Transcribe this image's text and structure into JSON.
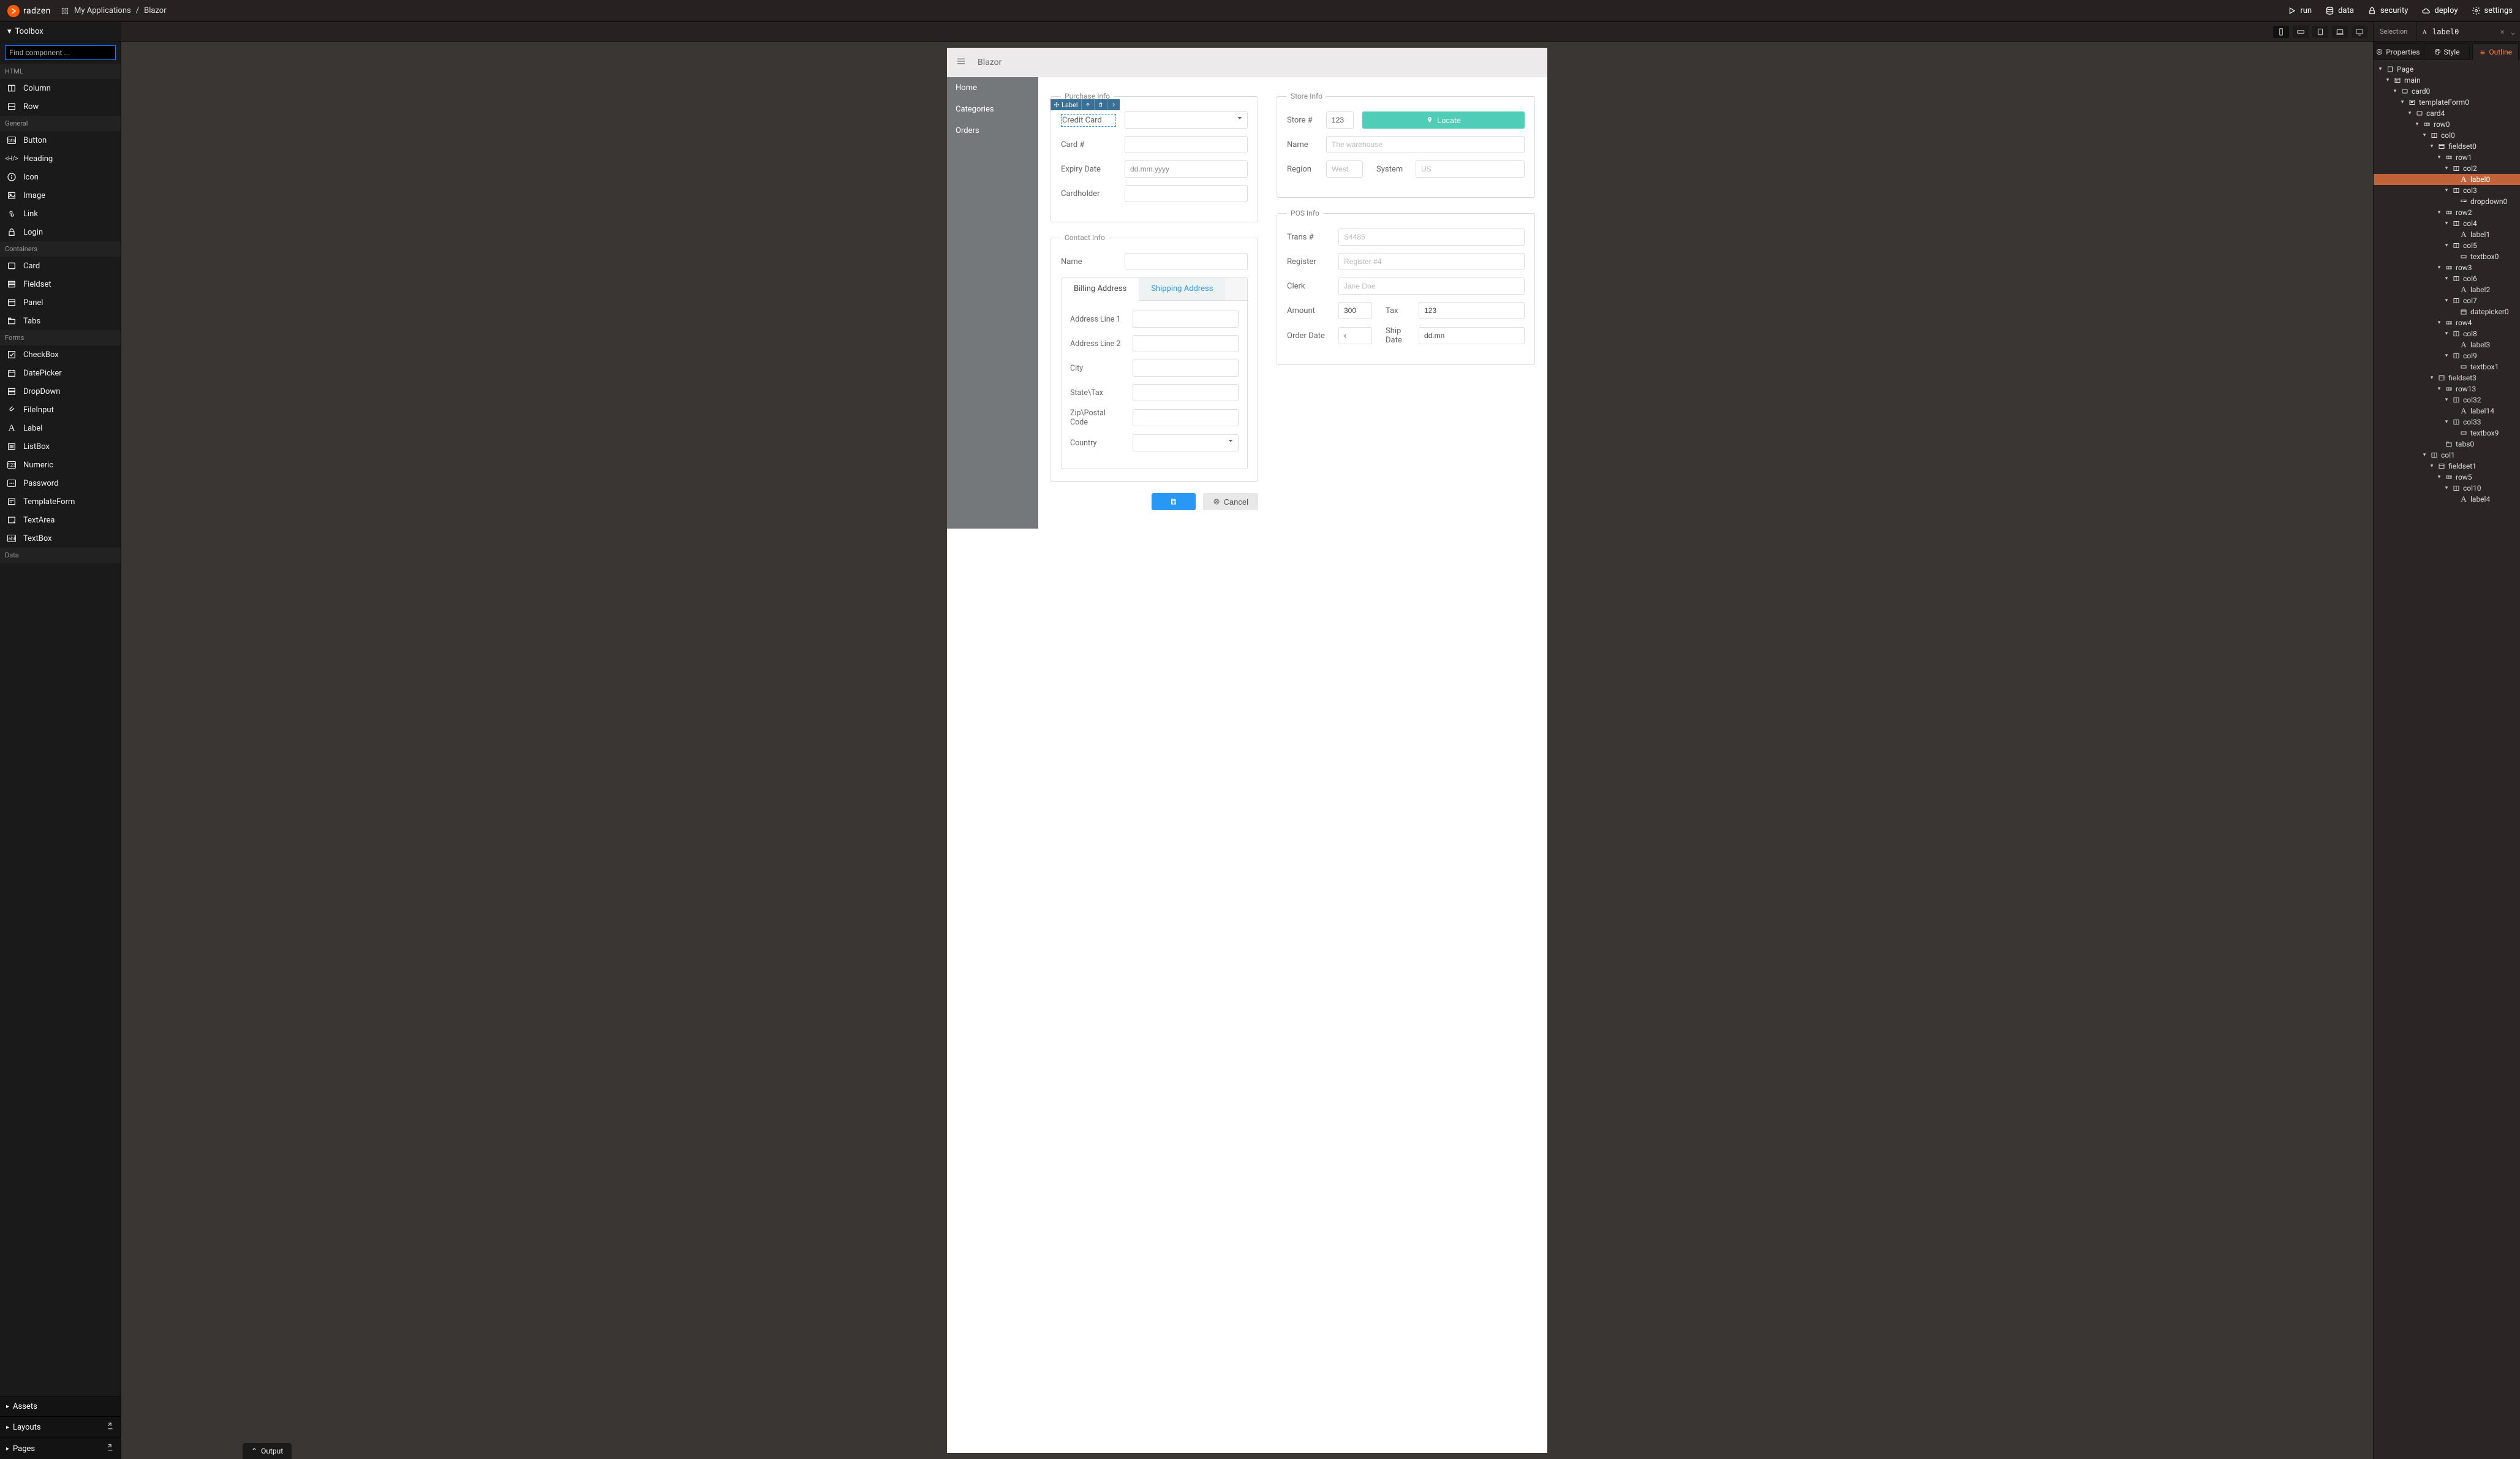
{
  "topbar": {
    "brand": "radzen",
    "breadcrumb1": "My Applications",
    "breadcrumb2": "Blazor",
    "run": "run",
    "data": "data",
    "security": "security",
    "deploy": "deploy",
    "settings": "settings"
  },
  "toolboxTitle": "Toolbox",
  "search_placeholder": "Find component ...",
  "toolbox": {
    "html": "HTML",
    "general": "General",
    "containers": "Containers",
    "forms": "Forms",
    "data": "Data",
    "column": "Column",
    "row": "Row",
    "button": "Button",
    "heading": "Heading",
    "icon": "Icon",
    "image": "Image",
    "link": "Link",
    "login": "Login",
    "card": "Card",
    "fieldset": "Fieldset",
    "panel": "Panel",
    "tabs": "Tabs",
    "checkbox": "CheckBox",
    "datepicker": "DatePicker",
    "dropdown": "DropDown",
    "fileinput": "FileInput",
    "label": "Label",
    "listbox": "ListBox",
    "numeric": "Numeric",
    "password": "Password",
    "templateform": "TemplateForm",
    "textarea": "TextArea",
    "textbox": "TextBox",
    "assets": "Assets",
    "layouts": "Layouts",
    "pages": "Pages"
  },
  "selection": {
    "label": "Selection",
    "value": "label0",
    "toolbar_label": "Label"
  },
  "canvas": {
    "app_title": "Blazor",
    "nav": {
      "home": "Home",
      "categories": "Categories",
      "orders": "Orders"
    },
    "purchase": {
      "legend": "Purchase Info",
      "credit_card": "Credit Card",
      "card_no": "Card #",
      "expiry": "Expiry Date",
      "expiry_value": "dd.mm.yyyy",
      "cardholder": "Cardholder"
    },
    "contact": {
      "legend": "Contact Info",
      "name": "Name",
      "tab_billing": "Billing Address",
      "tab_shipping": "Shipping Address",
      "addr1": "Address Line 1",
      "addr2": "Address Line 2",
      "city": "City",
      "state": "State\\Tax",
      "zip": "Zip\\Postal Code",
      "country": "Country"
    },
    "store": {
      "legend": "Store Info",
      "store_no": "Store #",
      "store_no_value": "123",
      "locate": "Locate",
      "name": "Name",
      "name_placeholder": "The warehouse",
      "region": "Region",
      "region_placeholder": "West",
      "system": "System",
      "system_placeholder": "US"
    },
    "pos": {
      "legend": "POS Info",
      "trans": "Trans #",
      "trans_placeholder": "S4485",
      "register": "Register",
      "register_placeholder": "Register #4",
      "clerk": "Clerk",
      "clerk_placeholder": "Jane Doe",
      "amount": "Amount",
      "amount_value": "300",
      "tax": "Tax",
      "tax_value": "123",
      "order_date": "Order Date",
      "order_date_value": "‹",
      "ship_date": "Ship Date",
      "ship_date_value": "dd.mn"
    },
    "actions": {
      "cancel": "Cancel"
    }
  },
  "rightpanel": {
    "properties": "Properties",
    "style": "Style",
    "outline": "Outline"
  },
  "outline": [
    {
      "d": 0,
      "t": "caret",
      "icon": "page",
      "label": "Page"
    },
    {
      "d": 1,
      "t": "caret",
      "icon": "layout",
      "label": "main"
    },
    {
      "d": 2,
      "t": "caret",
      "icon": "card",
      "label": "card0"
    },
    {
      "d": 3,
      "t": "caret",
      "icon": "form",
      "label": "templateForm0"
    },
    {
      "d": 4,
      "t": "caret",
      "icon": "card",
      "label": "card4"
    },
    {
      "d": 5,
      "t": "caret",
      "icon": "row",
      "label": "row0"
    },
    {
      "d": 6,
      "t": "caret",
      "icon": "col",
      "label": "col0"
    },
    {
      "d": 7,
      "t": "caret",
      "icon": "fieldset",
      "label": "fieldset0"
    },
    {
      "d": 8,
      "t": "caret",
      "icon": "row",
      "label": "row1"
    },
    {
      "d": 9,
      "t": "caret",
      "icon": "col",
      "label": "col2"
    },
    {
      "d": 10,
      "t": "leaf",
      "icon": "label",
      "label": "label0",
      "selected": true
    },
    {
      "d": 9,
      "t": "caret",
      "icon": "col",
      "label": "col3"
    },
    {
      "d": 10,
      "t": "leaf",
      "icon": "dropdown",
      "label": "dropdown0"
    },
    {
      "d": 8,
      "t": "caret",
      "icon": "row",
      "label": "row2"
    },
    {
      "d": 9,
      "t": "caret",
      "icon": "col",
      "label": "col4"
    },
    {
      "d": 10,
      "t": "leaf",
      "icon": "label",
      "label": "label1"
    },
    {
      "d": 9,
      "t": "caret",
      "icon": "col",
      "label": "col5"
    },
    {
      "d": 10,
      "t": "leaf",
      "icon": "textbox",
      "label": "textbox0"
    },
    {
      "d": 8,
      "t": "caret",
      "icon": "row",
      "label": "row3"
    },
    {
      "d": 9,
      "t": "caret",
      "icon": "col",
      "label": "col6"
    },
    {
      "d": 10,
      "t": "leaf",
      "icon": "label",
      "label": "label2"
    },
    {
      "d": 9,
      "t": "caret",
      "icon": "col",
      "label": "col7"
    },
    {
      "d": 10,
      "t": "leaf",
      "icon": "datepicker",
      "label": "datepicker0"
    },
    {
      "d": 8,
      "t": "caret",
      "icon": "row",
      "label": "row4"
    },
    {
      "d": 9,
      "t": "caret",
      "icon": "col",
      "label": "col8"
    },
    {
      "d": 10,
      "t": "leaf",
      "icon": "label",
      "label": "label3"
    },
    {
      "d": 9,
      "t": "caret",
      "icon": "col",
      "label": "col9"
    },
    {
      "d": 10,
      "t": "leaf",
      "icon": "textbox",
      "label": "textbox1"
    },
    {
      "d": 7,
      "t": "caret",
      "icon": "fieldset",
      "label": "fieldset3"
    },
    {
      "d": 8,
      "t": "caret",
      "icon": "row",
      "label": "row13"
    },
    {
      "d": 9,
      "t": "caret",
      "icon": "col",
      "label": "col32"
    },
    {
      "d": 10,
      "t": "leaf",
      "icon": "label",
      "label": "label14"
    },
    {
      "d": 9,
      "t": "caret",
      "icon": "col",
      "label": "col33"
    },
    {
      "d": 10,
      "t": "leaf",
      "icon": "textbox",
      "label": "textbox9"
    },
    {
      "d": 8,
      "t": "leaf",
      "icon": "tabs",
      "label": "tabs0"
    },
    {
      "d": 6,
      "t": "caret",
      "icon": "col",
      "label": "col1"
    },
    {
      "d": 7,
      "t": "caret",
      "icon": "fieldset",
      "label": "fieldset1"
    },
    {
      "d": 8,
      "t": "caret",
      "icon": "row",
      "label": "row5"
    },
    {
      "d": 9,
      "t": "caret",
      "icon": "col",
      "label": "col10"
    },
    {
      "d": 10,
      "t": "leaf",
      "icon": "label",
      "label": "label4"
    }
  ],
  "output": "Output"
}
